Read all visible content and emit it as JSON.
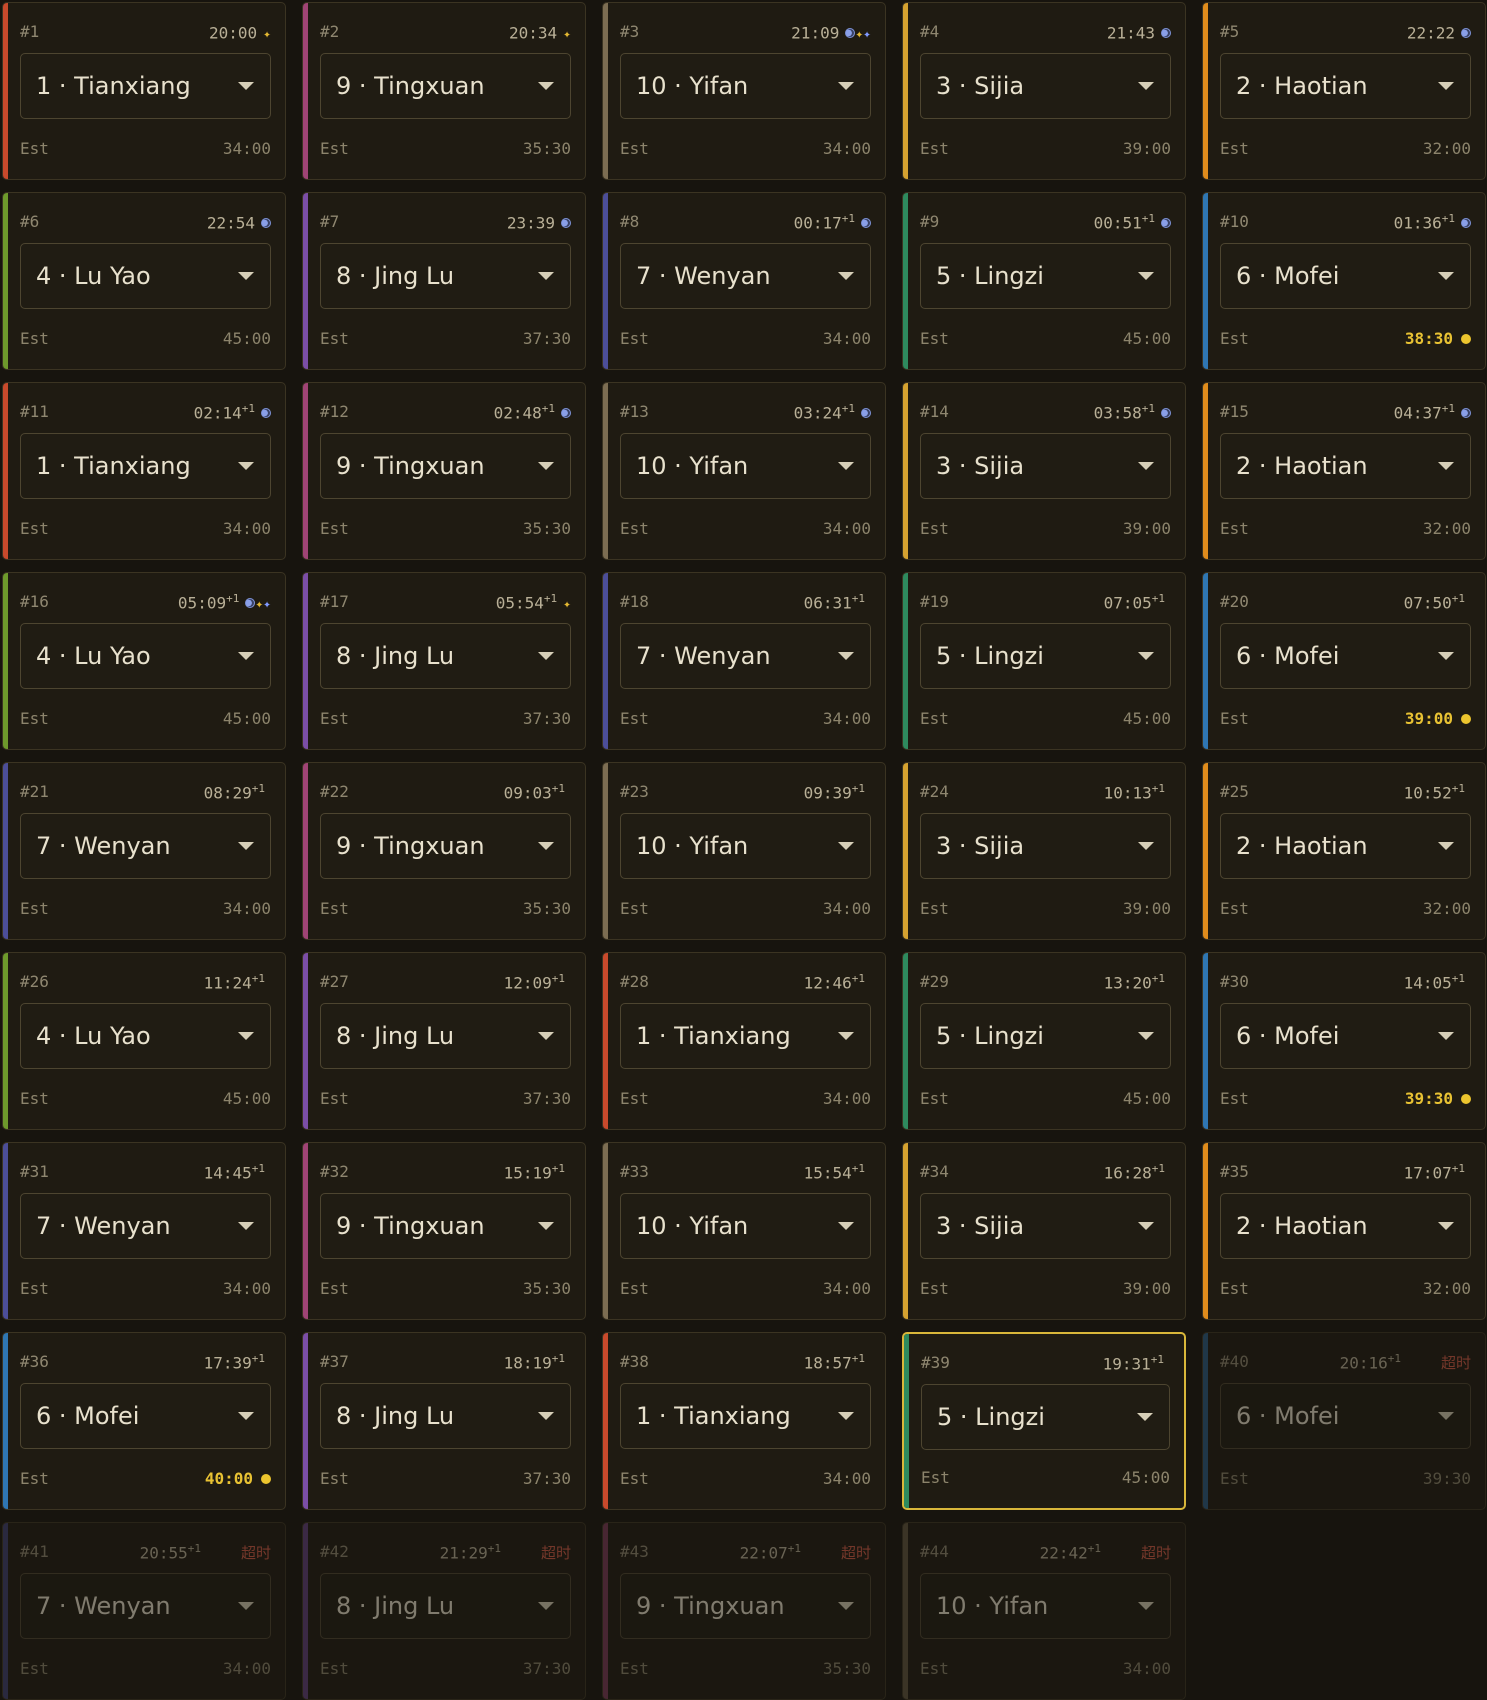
{
  "est_label": "Est",
  "overdue_label": "超时",
  "colors": {
    "Tianxiang": "#c84a2c",
    "Tingxuan": "#a04475",
    "Yifan": "#7c6d52",
    "Sijia": "#d5a230",
    "Haotian": "#e08c1c",
    "Lu Yao": "#6e9a2c",
    "Jing Lu": "#7b4ea6",
    "Wenyan": "#4c4e98",
    "Lingzi": "#2e8a5e",
    "Mofei": "#2f76b2"
  },
  "cards": [
    {
      "id": "#1",
      "time": "20:00",
      "day": "",
      "icons": [
        "star-gold"
      ],
      "label": "1 · Tianxiang",
      "name": "Tianxiang",
      "duration": "34:00",
      "highlight": false,
      "status": ""
    },
    {
      "id": "#2",
      "time": "20:34",
      "day": "",
      "icons": [
        "star-gold"
      ],
      "label": "9 · Tingxuan",
      "name": "Tingxuan",
      "duration": "35:30",
      "highlight": false,
      "status": ""
    },
    {
      "id": "#3",
      "time": "21:09",
      "day": "",
      "icons": [
        "moon",
        "star-gold",
        "star-blue"
      ],
      "label": "10 · Yifan",
      "name": "Yifan",
      "duration": "34:00",
      "highlight": false,
      "status": ""
    },
    {
      "id": "#4",
      "time": "21:43",
      "day": "",
      "icons": [
        "moon"
      ],
      "label": "3 · Sijia",
      "name": "Sijia",
      "duration": "39:00",
      "highlight": false,
      "status": ""
    },
    {
      "id": "#5",
      "time": "22:22",
      "day": "",
      "icons": [
        "moon"
      ],
      "label": "2 · Haotian",
      "name": "Haotian",
      "duration": "32:00",
      "highlight": false,
      "status": ""
    },
    {
      "id": "#6",
      "time": "22:54",
      "day": "",
      "icons": [
        "moon"
      ],
      "label": "4 · Lu Yao",
      "name": "Lu Yao",
      "duration": "45:00",
      "highlight": false,
      "status": ""
    },
    {
      "id": "#7",
      "time": "23:39",
      "day": "",
      "icons": [
        "moon"
      ],
      "label": "8 · Jing Lu",
      "name": "Jing Lu",
      "duration": "37:30",
      "highlight": false,
      "status": ""
    },
    {
      "id": "#8",
      "time": "00:17",
      "day": "+1",
      "icons": [
        "moon"
      ],
      "label": "7 · Wenyan",
      "name": "Wenyan",
      "duration": "34:00",
      "highlight": false,
      "status": ""
    },
    {
      "id": "#9",
      "time": "00:51",
      "day": "+1",
      "icons": [
        "moon"
      ],
      "label": "5 · Lingzi",
      "name": "Lingzi",
      "duration": "45:00",
      "highlight": false,
      "status": ""
    },
    {
      "id": "#10",
      "time": "01:36",
      "day": "+1",
      "icons": [
        "moon"
      ],
      "label": "6 · Mofei",
      "name": "Mofei",
      "duration": "38:30",
      "highlight": true,
      "status": ""
    },
    {
      "id": "#11",
      "time": "02:14",
      "day": "+1",
      "icons": [
        "moon"
      ],
      "label": "1 · Tianxiang",
      "name": "Tianxiang",
      "duration": "34:00",
      "highlight": false,
      "status": ""
    },
    {
      "id": "#12",
      "time": "02:48",
      "day": "+1",
      "icons": [
        "moon"
      ],
      "label": "9 · Tingxuan",
      "name": "Tingxuan",
      "duration": "35:30",
      "highlight": false,
      "status": ""
    },
    {
      "id": "#13",
      "time": "03:24",
      "day": "+1",
      "icons": [
        "moon"
      ],
      "label": "10 · Yifan",
      "name": "Yifan",
      "duration": "34:00",
      "highlight": false,
      "status": ""
    },
    {
      "id": "#14",
      "time": "03:58",
      "day": "+1",
      "icons": [
        "moon"
      ],
      "label": "3 · Sijia",
      "name": "Sijia",
      "duration": "39:00",
      "highlight": false,
      "status": ""
    },
    {
      "id": "#15",
      "time": "04:37",
      "day": "+1",
      "icons": [
        "moon"
      ],
      "label": "2 · Haotian",
      "name": "Haotian",
      "duration": "32:00",
      "highlight": false,
      "status": ""
    },
    {
      "id": "#16",
      "time": "05:09",
      "day": "+1",
      "icons": [
        "moon",
        "star-gold",
        "star-blue"
      ],
      "label": "4 · Lu Yao",
      "name": "Lu Yao",
      "duration": "45:00",
      "highlight": false,
      "status": ""
    },
    {
      "id": "#17",
      "time": "05:54",
      "day": "+1",
      "icons": [
        "star-gold"
      ],
      "label": "8 · Jing Lu",
      "name": "Jing Lu",
      "duration": "37:30",
      "highlight": false,
      "status": ""
    },
    {
      "id": "#18",
      "time": "06:31",
      "day": "+1",
      "icons": [],
      "label": "7 · Wenyan",
      "name": "Wenyan",
      "duration": "34:00",
      "highlight": false,
      "status": ""
    },
    {
      "id": "#19",
      "time": "07:05",
      "day": "+1",
      "icons": [],
      "label": "5 · Lingzi",
      "name": "Lingzi",
      "duration": "45:00",
      "highlight": false,
      "status": ""
    },
    {
      "id": "#20",
      "time": "07:50",
      "day": "+1",
      "icons": [],
      "label": "6 · Mofei",
      "name": "Mofei",
      "duration": "39:00",
      "highlight": true,
      "status": ""
    },
    {
      "id": "#21",
      "time": "08:29",
      "day": "+1",
      "icons": [],
      "label": "7 · Wenyan",
      "name": "Wenyan",
      "duration": "34:00",
      "highlight": false,
      "status": ""
    },
    {
      "id": "#22",
      "time": "09:03",
      "day": "+1",
      "icons": [],
      "label": "9 · Tingxuan",
      "name": "Tingxuan",
      "duration": "35:30",
      "highlight": false,
      "status": ""
    },
    {
      "id": "#23",
      "time": "09:39",
      "day": "+1",
      "icons": [],
      "label": "10 · Yifan",
      "name": "Yifan",
      "duration": "34:00",
      "highlight": false,
      "status": ""
    },
    {
      "id": "#24",
      "time": "10:13",
      "day": "+1",
      "icons": [],
      "label": "3 · Sijia",
      "name": "Sijia",
      "duration": "39:00",
      "highlight": false,
      "status": ""
    },
    {
      "id": "#25",
      "time": "10:52",
      "day": "+1",
      "icons": [],
      "label": "2 · Haotian",
      "name": "Haotian",
      "duration": "32:00",
      "highlight": false,
      "status": ""
    },
    {
      "id": "#26",
      "time": "11:24",
      "day": "+1",
      "icons": [],
      "label": "4 · Lu Yao",
      "name": "Lu Yao",
      "duration": "45:00",
      "highlight": false,
      "status": ""
    },
    {
      "id": "#27",
      "time": "12:09",
      "day": "+1",
      "icons": [],
      "label": "8 · Jing Lu",
      "name": "Jing Lu",
      "duration": "37:30",
      "highlight": false,
      "status": ""
    },
    {
      "id": "#28",
      "time": "12:46",
      "day": "+1",
      "icons": [],
      "label": "1 · Tianxiang",
      "name": "Tianxiang",
      "duration": "34:00",
      "highlight": false,
      "status": ""
    },
    {
      "id": "#29",
      "time": "13:20",
      "day": "+1",
      "icons": [],
      "label": "5 · Lingzi",
      "name": "Lingzi",
      "duration": "45:00",
      "highlight": false,
      "status": ""
    },
    {
      "id": "#30",
      "time": "14:05",
      "day": "+1",
      "icons": [],
      "label": "6 · Mofei",
      "name": "Mofei",
      "duration": "39:30",
      "highlight": true,
      "status": ""
    },
    {
      "id": "#31",
      "time": "14:45",
      "day": "+1",
      "icons": [],
      "label": "7 · Wenyan",
      "name": "Wenyan",
      "duration": "34:00",
      "highlight": false,
      "status": ""
    },
    {
      "id": "#32",
      "time": "15:19",
      "day": "+1",
      "icons": [],
      "label": "9 · Tingxuan",
      "name": "Tingxuan",
      "duration": "35:30",
      "highlight": false,
      "status": ""
    },
    {
      "id": "#33",
      "time": "15:54",
      "day": "+1",
      "icons": [],
      "label": "10 · Yifan",
      "name": "Yifan",
      "duration": "34:00",
      "highlight": false,
      "status": ""
    },
    {
      "id": "#34",
      "time": "16:28",
      "day": "+1",
      "icons": [],
      "label": "3 · Sijia",
      "name": "Sijia",
      "duration": "39:00",
      "highlight": false,
      "status": ""
    },
    {
      "id": "#35",
      "time": "17:07",
      "day": "+1",
      "icons": [],
      "label": "2 · Haotian",
      "name": "Haotian",
      "duration": "32:00",
      "highlight": false,
      "status": ""
    },
    {
      "id": "#36",
      "time": "17:39",
      "day": "+1",
      "icons": [],
      "label": "6 · Mofei",
      "name": "Mofei",
      "duration": "40:00",
      "highlight": true,
      "status": ""
    },
    {
      "id": "#37",
      "time": "18:19",
      "day": "+1",
      "icons": [],
      "label": "8 · Jing Lu",
      "name": "Jing Lu",
      "duration": "37:30",
      "highlight": false,
      "status": ""
    },
    {
      "id": "#38",
      "time": "18:57",
      "day": "+1",
      "icons": [],
      "label": "1 · Tianxiang",
      "name": "Tianxiang",
      "duration": "34:00",
      "highlight": false,
      "status": ""
    },
    {
      "id": "#39",
      "time": "19:31",
      "day": "+1",
      "icons": [],
      "label": "5 · Lingzi",
      "name": "Lingzi",
      "duration": "45:00",
      "highlight": false,
      "status": "selected"
    },
    {
      "id": "#40",
      "time": "20:16",
      "day": "+1",
      "icons": [],
      "label": "6 · Mofei",
      "name": "Mofei",
      "duration": "39:30",
      "highlight": false,
      "status": "overdue"
    },
    {
      "id": "#41",
      "time": "20:55",
      "day": "+1",
      "icons": [],
      "label": "7 · Wenyan",
      "name": "Wenyan",
      "duration": "34:00",
      "highlight": false,
      "status": "overdue"
    },
    {
      "id": "#42",
      "time": "21:29",
      "day": "+1",
      "icons": [],
      "label": "8 · Jing Lu",
      "name": "Jing Lu",
      "duration": "37:30",
      "highlight": false,
      "status": "overdue"
    },
    {
      "id": "#43",
      "time": "22:07",
      "day": "+1",
      "icons": [],
      "label": "9 · Tingxuan",
      "name": "Tingxuan",
      "duration": "35:30",
      "highlight": false,
      "status": "overdue"
    },
    {
      "id": "#44",
      "time": "22:42",
      "day": "+1",
      "icons": [],
      "label": "10 · Yifan",
      "name": "Yifan",
      "duration": "34:00",
      "highlight": false,
      "status": "overdue"
    }
  ]
}
